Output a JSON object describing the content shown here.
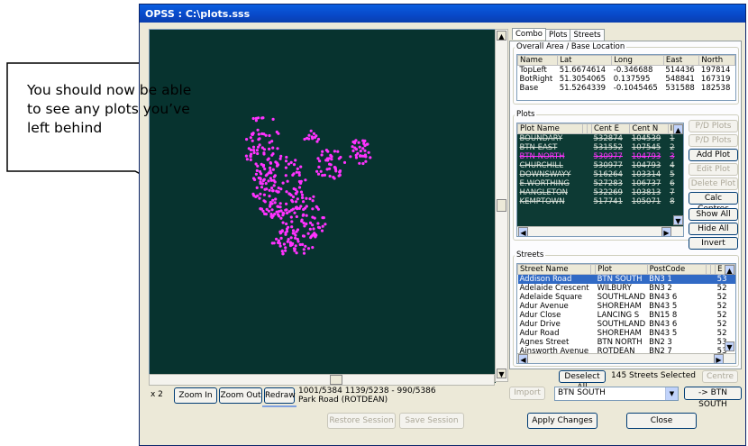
{
  "window": {
    "title": "OPSS : C:\\plots.sss"
  },
  "callout": {
    "text": "You should now be able to see any plots you’ve left behind"
  },
  "map": {
    "zoom_level": "x 2",
    "zoom_in_label": "Zoom In",
    "zoom_out_label": "Zoom Out",
    "redraw_label": "Redraw",
    "coords_line1": "1001/5384    1139/5238 - 990/5386",
    "coords_line2": "Park Road (ROTDEAN)",
    "dot_color": "#ff33ff",
    "bg_color": "#07332f"
  },
  "tabs": [
    {
      "label": "Combo",
      "active": true
    },
    {
      "label": "Plots",
      "active": false
    },
    {
      "label": "Streets",
      "active": false
    }
  ],
  "overall": {
    "title": "Overall Area / Base Location",
    "headers": [
      "Name",
      "Lat",
      "Long",
      "East",
      "North"
    ],
    "rows": [
      [
        "TopLeft",
        "51.6674614",
        "-0.346688",
        "514436",
        "197814"
      ],
      [
        "BotRight",
        "51.3054065",
        "0.137595",
        "548841",
        "167319"
      ],
      [
        "Base",
        "51.5264339",
        "-0.1045465",
        "531588",
        "182538"
      ]
    ]
  },
  "plots": {
    "title": "Plots",
    "headers": [
      "Plot Name",
      "",
      "",
      "Cent E",
      "Cent N",
      "ID"
    ],
    "rows": [
      {
        "name": "BOUNDARY",
        "e": "532874",
        "n": "104539",
        "id": "1",
        "pink": false
      },
      {
        "name": "BTN EAST",
        "e": "531552",
        "n": "107545",
        "id": "2",
        "pink": false
      },
      {
        "name": "BTN NORTH",
        "e": "530977",
        "n": "104793",
        "id": "3",
        "pink": true
      },
      {
        "name": "CHURCHILL",
        "e": "530977",
        "n": "104793",
        "id": "4",
        "pink": false
      },
      {
        "name": "DOWNSWAYY",
        "e": "516264",
        "n": "103314",
        "id": "5",
        "pink": false
      },
      {
        "name": "E.WORTHING",
        "e": "527283",
        "n": "106737",
        "id": "6",
        "pink": false
      },
      {
        "name": "HANGLETON",
        "e": "532269",
        "n": "103813",
        "id": "7",
        "pink": false
      },
      {
        "name": "KEMPTOWN",
        "e": "517741",
        "n": "105071",
        "id": "8",
        "pink": false
      }
    ],
    "buttons": {
      "pd_plots": "P/D Plots",
      "pvd_plots": "P/D Plots",
      "add_plot": "Add Plot",
      "edit_plot": "Edit Plot",
      "delete_plot": "Delete Plot",
      "calc_centres": "Calc Centres",
      "show_all": "Show All",
      "hide_all": "Hide All",
      "invert": "Invert"
    }
  },
  "streets": {
    "title": "Streets",
    "headers": [
      "Street Name",
      "",
      "Plot",
      "PostCode",
      "",
      "",
      "E"
    ],
    "rows": [
      {
        "name": "Addison Road",
        "plot": "BTN SOUTH",
        "pc": "BN3 1",
        "e": "53",
        "sel": true
      },
      {
        "name": "Adelaide Crescent",
        "plot": "WILBURY",
        "pc": "BN3 2",
        "e": "52",
        "sel": false
      },
      {
        "name": "Adelaide Square",
        "plot": "SOUTHLAND",
        "pc": "BN43 6",
        "e": "52",
        "sel": false
      },
      {
        "name": "Adur Avenue",
        "plot": "SHOREHAM",
        "pc": "BN43 5",
        "e": "52",
        "sel": false
      },
      {
        "name": "Adur Close",
        "plot": "LANCING S",
        "pc": "BN15 8",
        "e": "52",
        "sel": false
      },
      {
        "name": "Adur Drive",
        "plot": "SOUTHLAND",
        "pc": "BN43 6",
        "e": "52",
        "sel": false
      },
      {
        "name": "Adur Road",
        "plot": "SHOREHAM",
        "pc": "BN43 5",
        "e": "52",
        "sel": false
      },
      {
        "name": "Agnes Street",
        "plot": "BTN NORTH",
        "pc": "BN2 3",
        "e": "53",
        "sel": false
      },
      {
        "name": "Ainsworth Avenue",
        "plot": "ROTDEAN",
        "pc": "BN2 7",
        "e": "53",
        "sel": false
      }
    ],
    "deselect_all": "Deselect All",
    "selected_count": "145 Streets Selected",
    "centre": "Centre",
    "import": "Import",
    "plot_select": "BTN SOUTH",
    "assign": "-> BTN SOUTH"
  },
  "footer": {
    "restore_session": "Restore Session",
    "save_session": "Save Session",
    "apply_changes": "Apply Changes",
    "close": "Close"
  }
}
